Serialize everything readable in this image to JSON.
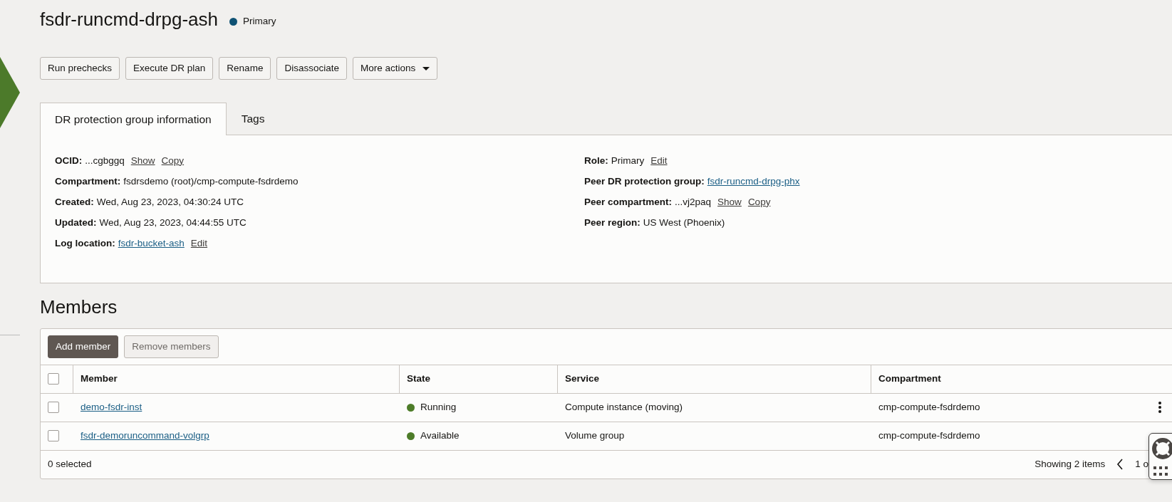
{
  "header": {
    "title": "fsdr-runcmd-drpg-ash",
    "status": {
      "label": "Primary",
      "color": "#0f5274"
    }
  },
  "actions": [
    {
      "label": "Run prechecks",
      "kind": "button"
    },
    {
      "label": "Execute DR plan",
      "kind": "button"
    },
    {
      "label": "Rename",
      "kind": "button"
    },
    {
      "label": "Disassociate",
      "kind": "button"
    },
    {
      "label": "More actions",
      "kind": "dropdown"
    }
  ],
  "tabs": [
    {
      "label": "DR protection group information",
      "selected": true
    },
    {
      "label": "Tags",
      "selected": false
    }
  ],
  "info": {
    "left": [
      {
        "label": "OCID:",
        "value": "...cgbggq",
        "actions": [
          "Show",
          "Copy"
        ]
      },
      {
        "label": "Compartment:",
        "value": "fsdrsdemo (root)/cmp-compute-fsdrdemo"
      },
      {
        "label": "Created:",
        "value": "Wed, Aug 23, 2023, 04:30:24 UTC"
      },
      {
        "label": "Updated:",
        "value": "Wed, Aug 23, 2023, 04:44:55 UTC"
      },
      {
        "label": "Log location:",
        "link": "fsdr-bucket-ash",
        "actions": [
          "Edit"
        ]
      }
    ],
    "right": [
      {
        "label": "Role:",
        "value": "Primary",
        "actions": [
          "Edit"
        ]
      },
      {
        "label": "Peer DR protection group:",
        "link": "fsdr-runcmd-drpg-phx"
      },
      {
        "label": "Peer compartment:",
        "value": "...vj2paq",
        "actions": [
          "Show",
          "Copy"
        ]
      },
      {
        "label": "Peer region:",
        "value": "US West (Phoenix)"
      }
    ]
  },
  "members": {
    "heading": "Members",
    "buttons": [
      {
        "label": "Add member",
        "disabled": false
      },
      {
        "label": "Remove members",
        "disabled": true
      }
    ],
    "select_all": {
      "checked": false
    },
    "columns": [
      "Member",
      "State",
      "Service",
      "Compartment"
    ],
    "rows": [
      {
        "checked": false,
        "member": "demo-fsdr-inst",
        "state": "Running",
        "color": "#4d7c29",
        "service": "Compute instance (moving)",
        "compartment": "cmp-compute-fsdrdemo",
        "menu": true
      },
      {
        "checked": false,
        "member": "fsdr-demoruncommand-volgrp",
        "state": "Available",
        "color": "#4d7c29",
        "service": "Volume group",
        "compartment": "cmp-compute-fsdrdemo",
        "menu": false
      }
    ],
    "footer": {
      "selected": "0 selected",
      "showing": "Showing 2 items",
      "page": "1 o"
    }
  }
}
